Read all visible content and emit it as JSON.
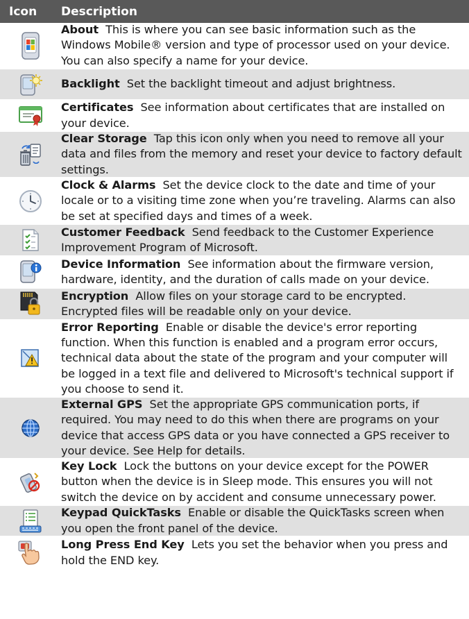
{
  "header": {
    "icon": "Icon",
    "description": "Description"
  },
  "rows": [
    {
      "title": "About",
      "text": "This is where you can see basic information such as the Windows Mobile® version and type of processor used on your device. You can also specify a name for your device.",
      "icon": "windows-device-icon"
    },
    {
      "title": "Backlight",
      "text": "Set the backlight timeout and adjust brightness.",
      "icon": "backlight-icon"
    },
    {
      "title": "Certificates",
      "text": "See information about certificates that are installed on your device.",
      "icon": "certificate-icon"
    },
    {
      "title": "Clear Storage",
      "text": "Tap this icon only when you need to remove all your data and files from the memory and reset your device to factory default settings.",
      "icon": "clear-storage-icon"
    },
    {
      "title": "Clock & Alarms",
      "text": "Set the device clock to the date and time of your locale or to a visiting time zone when you’re traveling. Alarms can also be set at specified days and times of a week.",
      "icon": "clock-icon"
    },
    {
      "title": "Customer Feedback",
      "text": "Send feedback to the Customer Experience Improvement Program of Microsoft.",
      "icon": "checklist-icon"
    },
    {
      "title": "Device Information",
      "text": "See information about the firmware version, hardware, identity, and the duration of calls made on your device.",
      "icon": "device-info-icon"
    },
    {
      "title": "Encryption",
      "text": "Allow files on your storage card to be encrypted. Encrypted files will be readable only on your device.",
      "icon": "encryption-lock-icon"
    },
    {
      "title": "Error Reporting",
      "text": "Enable or disable the device's error reporting function. When this function is enabled and a program error occurs, technical data about the state of the program and your computer will be logged in a text file and delivered to Microsoft's technical support if you choose to send it.",
      "icon": "error-warning-icon"
    },
    {
      "title": "External GPS",
      "text": "Set the appropriate GPS communication ports, if required. You may need to do this when there are programs on your device that access GPS data or you have connected a GPS receiver to your device. See Help for details.",
      "icon": "globe-icon"
    },
    {
      "title": "Key Lock",
      "text": "Lock the buttons on your device except for the POWER button when the device is in Sleep mode. This ensures you will not switch the device on by accident and consume unnecessary power.",
      "icon": "key-lock-icon"
    },
    {
      "title": "Keypad QuickTasks",
      "text": "Enable or disable the QuickTasks screen when you open the front panel of the device.",
      "icon": "keypad-tasks-icon"
    },
    {
      "title": "Long Press End Key",
      "text": "Lets you set the behavior when you press and hold the END key.",
      "icon": "hand-press-icon"
    }
  ]
}
